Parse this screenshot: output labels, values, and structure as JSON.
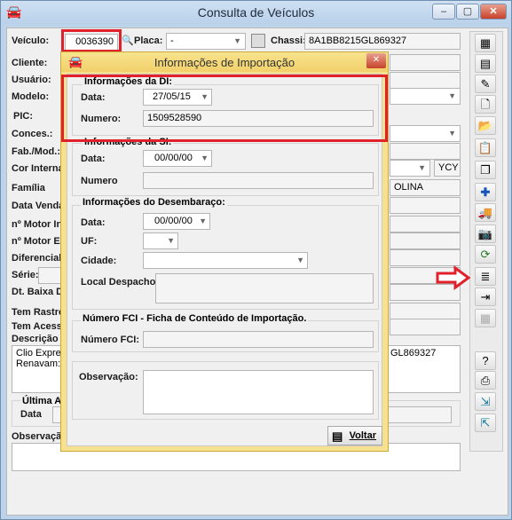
{
  "window": {
    "title": "Consulta de Veículos",
    "btn_min": "▭",
    "btn_max": "▢",
    "btn_close": "✕"
  },
  "main": {
    "veiculo_label": "Veículo:",
    "veiculo_value": "0036390",
    "placa_label": "Placa:",
    "placa_value": "-",
    "chassi_label": "Chassi:",
    "chassi_value": "8A1BB8215GL869327",
    "left_labels": [
      "Cliente:",
      "Usuário:",
      "Modelo:",
      "PIC:",
      "Conces.:",
      "Fab./Mod.:",
      "Cor Interna:",
      "Família",
      "Data Venda",
      "nº Motor Int.",
      "nº Motor Ext.",
      "Diferencial:",
      "Série:",
      "Dt. Baixa De",
      "Tem Rastread",
      "Tem Acessó",
      "Descrição d"
    ],
    "cor_right_value": "YCY",
    "familia_right_value": "OLINA",
    "descricao_text": "Clio Express",
    "renavam_text": "Renavam: 1",
    "descricao_chassi_tail": "GL869327",
    "ultima_label": "Última Av",
    "data_label": "Data",
    "observacao_label": "Observação"
  },
  "dialog": {
    "title": "Informações de Importação",
    "close": "✕",
    "di_group": "Informações da DI:",
    "di_data_label": "Data:",
    "di_data_value": "27/05/15",
    "di_numero_label": "Numero:",
    "di_numero_value": "1509528590",
    "si_group": "Informações da SI:",
    "si_data_label": "Data:",
    "si_data_value": "00/00/00",
    "si_numero_label": "Numero",
    "desemb_group": "Informações do Desembaraço:",
    "desemb_data_label": "Data:",
    "desemb_data_value": "00/00/00",
    "desemb_uf_label": "UF:",
    "desemb_cidade_label": "Cidade:",
    "desemb_local_label": "Local Despacho:",
    "fci_group": "Número  FCI - Ficha de Conteúdo de Importação.",
    "fci_label": "Número FCI:",
    "obs_label": "Observação:",
    "voltar_label": "Voltar"
  },
  "toolbar_icons": [
    "grid-add-icon",
    "grid-edit-icon",
    "eraser-icon",
    "document-icon",
    "folder-open-icon",
    "clipboard-icon",
    "copy-icon",
    "add-plus-icon",
    "camera-truck-icon",
    "camera-icon",
    "refresh-icon",
    "import-info-icon",
    "export-list-icon",
    "disabled-grid-icon",
    "help-icon",
    "print-icon",
    "door-enter-icon",
    "door-exit-icon"
  ],
  "colors": {
    "highlight_red": "#e0202a",
    "dialog_gold": "#f1d06a",
    "title_blue": "#cfe0f2"
  }
}
